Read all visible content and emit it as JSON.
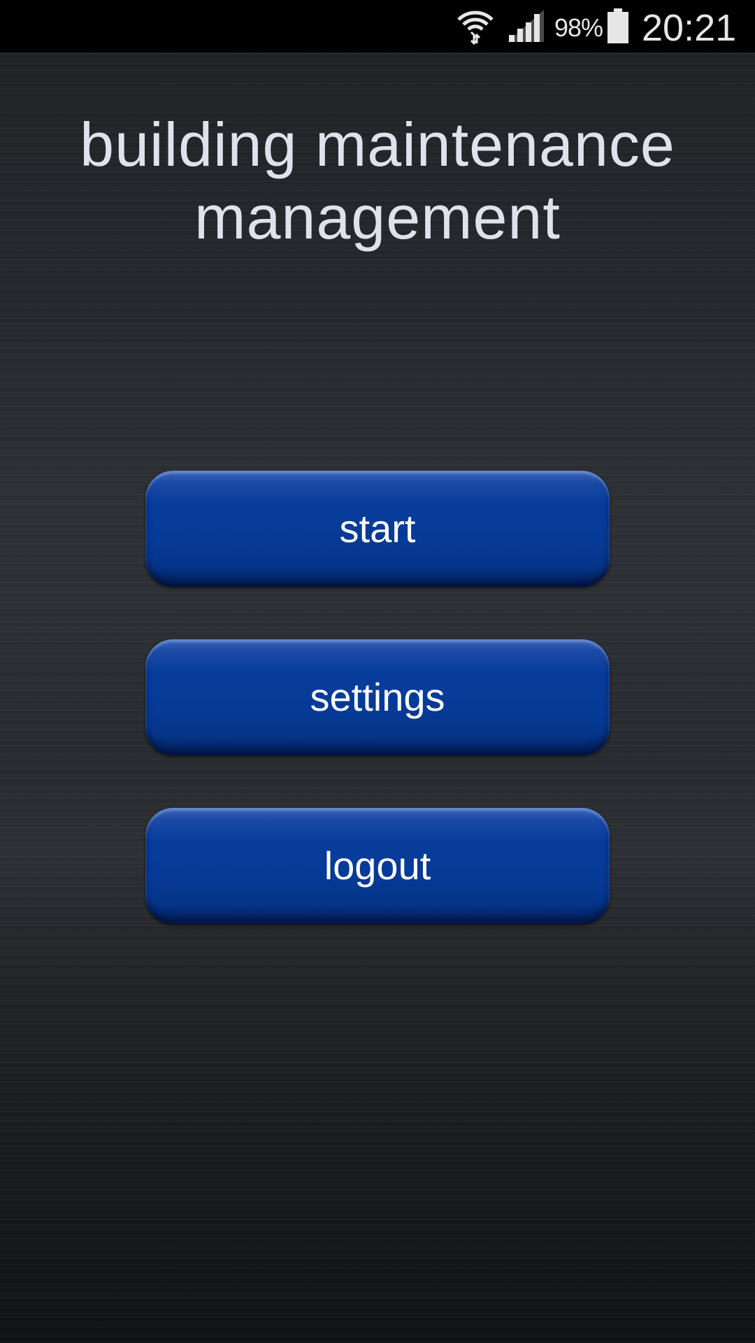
{
  "status_bar": {
    "battery_percent": "98%",
    "clock": "20:21",
    "icons": [
      "wifi-icon",
      "signal-icon",
      "battery-icon"
    ]
  },
  "app": {
    "title": "building maintenance management"
  },
  "menu": {
    "start_label": "start",
    "settings_label": "settings",
    "logout_label": "logout"
  },
  "colors": {
    "button_blue": "#063a96",
    "title_text": "#dfe2ea",
    "background": "#2b2e33"
  }
}
